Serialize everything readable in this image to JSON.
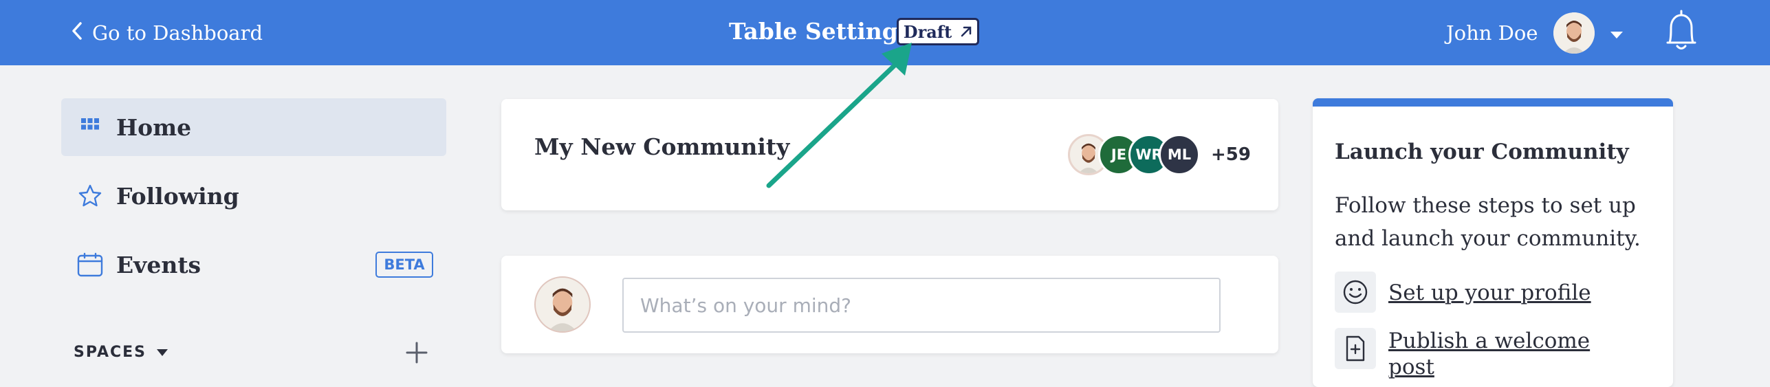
{
  "header": {
    "back_label": "Go to Dashboard",
    "title": "Table Setting",
    "draft_label": "Draft",
    "user_name": "John Doe"
  },
  "sidebar": {
    "items": [
      {
        "label": "Home",
        "icon": "grid-icon",
        "active": true
      },
      {
        "label": "Following",
        "icon": "star-icon"
      },
      {
        "label": "Events",
        "icon": "calendar-icon",
        "badge": "BETA"
      }
    ],
    "section_label": "SPACES"
  },
  "community": {
    "name": "My New Community",
    "members": [
      {
        "initials": "",
        "color": "#f3efe9"
      },
      {
        "initials": "JE",
        "color": "#1f6b3a"
      },
      {
        "initials": "WR",
        "color": "#0d6b5b"
      },
      {
        "initials": "ML",
        "color": "#2e3446"
      }
    ],
    "more_count": "+59"
  },
  "composer": {
    "placeholder": "What’s on your mind?"
  },
  "launch": {
    "title": "Launch your Community",
    "description": "Follow these steps to set up and launch your community.",
    "steps": [
      {
        "label": "Set up your profile",
        "icon": "smiley-icon"
      },
      {
        "label": "Publish a welcome post",
        "icon": "add-document-icon"
      }
    ]
  },
  "colors": {
    "brand_blue": "#3e7bdc",
    "annotation_arrow": "#1aa58a"
  }
}
